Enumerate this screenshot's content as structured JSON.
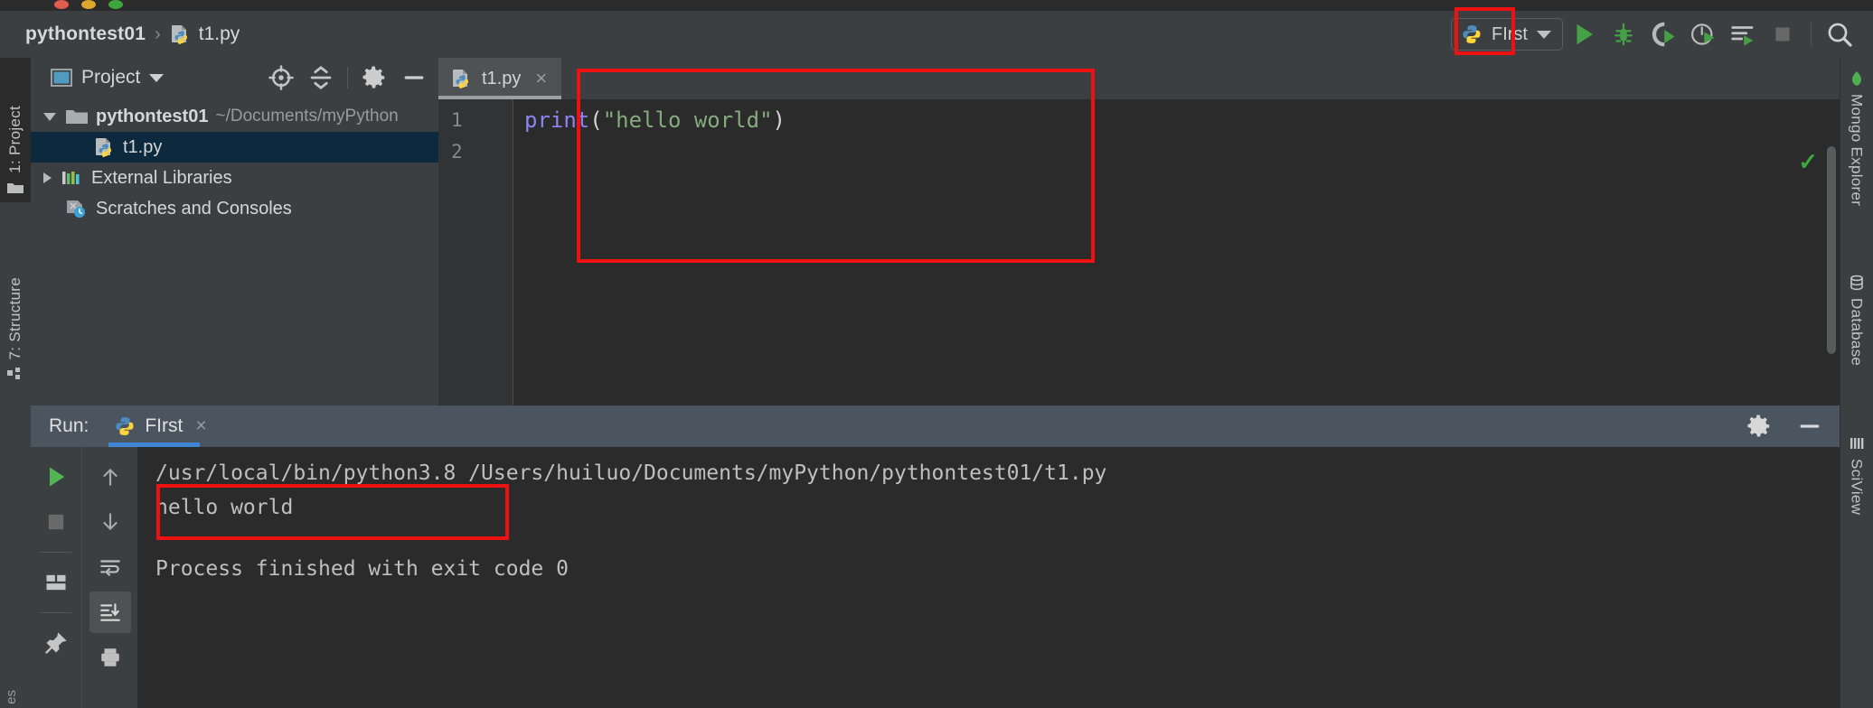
{
  "window": {
    "traffic_lights": [
      "close",
      "minimize",
      "zoom"
    ]
  },
  "breadcrumb": {
    "project": "pythontest01",
    "separator": "›",
    "file": "t1.py"
  },
  "toolbar": {
    "run_config_name": "FIrst",
    "buttons": [
      {
        "name": "run-button",
        "title": "Run",
        "highlighted": true
      },
      {
        "name": "debug-button",
        "title": "Debug"
      },
      {
        "name": "coverage-button",
        "title": "Run with Coverage"
      },
      {
        "name": "profile-button",
        "title": "Profile"
      },
      {
        "name": "run-with-console-button",
        "title": "Run with Console"
      },
      {
        "name": "stop-button",
        "title": "Stop"
      },
      {
        "name": "search-button",
        "title": "Search Everywhere"
      }
    ]
  },
  "left_tool_strip": {
    "tabs": [
      {
        "label": "1: Project",
        "active": true
      },
      {
        "label": "7: Structure",
        "active": false
      },
      {
        "label": "es",
        "active": false
      }
    ]
  },
  "right_tool_strip": {
    "tabs": [
      {
        "label": "Mongo Explorer"
      },
      {
        "label": "Database"
      },
      {
        "label": "SciView"
      }
    ]
  },
  "project_panel": {
    "title": "Project",
    "header_icons": [
      "locate-icon",
      "collapse-all-icon",
      "settings-icon",
      "minimize-icon"
    ],
    "tree": [
      {
        "label": "pythontest01",
        "path": "~/Documents/myPython",
        "type": "folder",
        "expanded": true,
        "selected": false
      },
      {
        "label": "t1.py",
        "path": "",
        "type": "python-file",
        "expanded": false,
        "selected": true
      },
      {
        "label": "External Libraries",
        "path": "",
        "type": "library",
        "expanded": false,
        "selected": false
      },
      {
        "label": "Scratches and Consoles",
        "path": "",
        "type": "scratch",
        "expanded": false,
        "selected": false
      }
    ]
  },
  "editor": {
    "tab": {
      "label": "t1.py",
      "close": "×"
    },
    "line_numbers": [
      "1",
      "2"
    ],
    "code": {
      "func": "print",
      "open_paren": "(",
      "string": "\"hello world\"",
      "close_paren": ")"
    },
    "inspection_status": "✓"
  },
  "run_panel": {
    "label": "Run:",
    "tab_name": "FIrst",
    "tab_close": "×",
    "header_icons": [
      "settings-icon",
      "minimize-icon"
    ],
    "left_tools": [
      "rerun-icon",
      "stop-icon",
      "layout-icon",
      "pin-icon"
    ],
    "left_tools2": [
      "up-arrow-icon",
      "down-arrow-icon",
      "soft-wrap-icon",
      "scroll-to-end-icon",
      "print-icon"
    ],
    "console_lines": [
      "/usr/local/bin/python3.8 /Users/huiluo/Documents/myPython/pythontest01/t1.py",
      "hello world",
      "",
      "Process finished with exit code 0"
    ]
  },
  "annotations": [
    {
      "name": "run-button-highlight"
    },
    {
      "name": "editor-highlight"
    },
    {
      "name": "console-output-highlight"
    }
  ],
  "colors": {
    "accent_red": "#ee1111",
    "run_green": "#3fa63f",
    "tab_underline": "#3e86d4",
    "selection_blue": "#0d293e",
    "string_green": "#83ab7c",
    "keyword_purple": "#8e82f5"
  },
  "corner_label": "es"
}
